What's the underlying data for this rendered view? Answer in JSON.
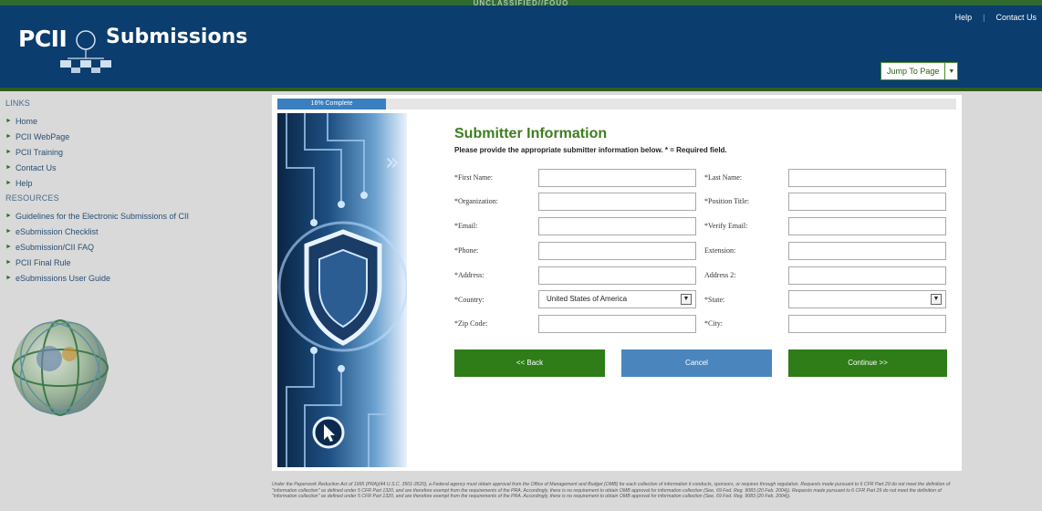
{
  "header": {
    "banner": "UNCLASSIFIED//FOUO",
    "logo_left": "PCII",
    "logo_right": "Submissions",
    "links": [
      "Help",
      "|",
      "Contact Us"
    ],
    "jump_label": "Jump To Page"
  },
  "sidebar": {
    "links_title": "LINKS",
    "links": [
      "Home",
      "PCII WebPage",
      "PCII Training",
      "Contact Us",
      "Help"
    ],
    "resources_title": "RESOURCES",
    "resources": [
      "Guidelines for the Electronic Submissions of CII",
      "eSubmission Checklist",
      "eSubmission/CII FAQ",
      "PCII Final Rule",
      "eSubmissions User Guide"
    ]
  },
  "progress": {
    "label": "16% Complete",
    "fraction": 0.16
  },
  "form": {
    "title": "Submitter Information",
    "subtitle": "Please provide the appropriate submitter information below. * = Required field.",
    "labels": {
      "first_name": "*First Name:",
      "last_name": "*Last Name:",
      "organization": "*Organization:",
      "position_title": "*Position Title:",
      "email": "*Email:",
      "verify_email": "*Verify Email:",
      "phone": "*Phone:",
      "extension": "Extension:",
      "address": "*Address:",
      "address2": "Address 2:",
      "country": "*Country:",
      "state": "*State:",
      "zip": "*Zip Code:",
      "city": "*City:"
    },
    "country_value": "United States of America",
    "state_value": ""
  },
  "buttons": {
    "back": "<< Back",
    "cancel": "Cancel",
    "continue": "Continue >>"
  },
  "footer": "Under the Paperwork Reduction Act of 1995 (PRA)(44 U.S.C. 3501-3520), a Federal agency must obtain approval from the Office of Management and Budget (OMB) for each collection of information it conducts, sponsors, or requires through regulation. Requests made pursuant to 6 CFR Part 29 do not meet the definition of \"information collection\" as defined under 5 CFR Part 1320, and are therefore exempt from the requirements of the PRA. Accordingly, there is no requirement to obtain OMB approval for information collection (See, 69 Fed. Reg. 9083 (20 Feb. 2004)). Requests made pursuant to 6 CFR Part 29 do not meet the definition of \"information collection\" as defined under 5 CFR Part 1320, and are therefore exempt from the requirements of the PRA. Accordingly, there is no requirement to obtain OMB approval for information collection (See, 69 Fed. Reg. 9083 (20 Feb. 2004))."
}
